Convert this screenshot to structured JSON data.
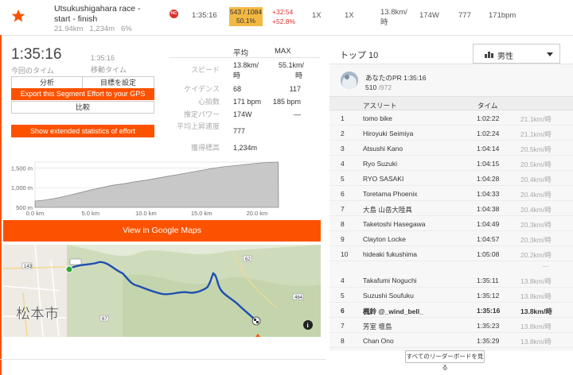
{
  "segment": {
    "title": "Utsukushigahara race -start - finish",
    "distance": "21.94km",
    "elevation": "1,234m",
    "grade": "6%",
    "category_badge": "HC",
    "time": "1:35:16",
    "rank": "543 / 1084",
    "percentile": "50.1%",
    "diff_time": "+32:54",
    "diff_pct": "+52.8%",
    "col_a": "1X",
    "col_b": "1X",
    "speed": "13.8km/時",
    "power": "174W",
    "col_c": "777",
    "heartrate": "171bpm",
    "colors": {
      "accent": "#fc5200",
      "rank_box": "#f3b843",
      "badge": "#d9302a"
    }
  },
  "effort": {
    "elapsed_time": "1:35:16",
    "elapsed_label": "今回のタイム",
    "moving_time": "1:35:16",
    "moving_label": "移動タイム",
    "analyze_label": "分析",
    "set_goal_label": "目標を設定",
    "export_label": "Export this Segment Effort to your GPS",
    "compare_label": "比較",
    "extended_label": "Show extended statistics of effort"
  },
  "stats": {
    "col_avg": "平均",
    "col_max": "MAX",
    "rows": [
      {
        "label": "スピード",
        "avg": "13.8km/時",
        "max": "55.1km/時"
      },
      {
        "label": "ケイデンス",
        "avg": "68",
        "max": "117"
      },
      {
        "label": "心拍数",
        "avg": "171 bpm",
        "max": "185 bpm"
      },
      {
        "label": "推定パワー",
        "avg": "174W",
        "max": "—"
      },
      {
        "label": "平均上昇速度",
        "avg": "777",
        "max": ""
      },
      {
        "label": "獲得標高",
        "avg": "1,234m",
        "max": ""
      }
    ]
  },
  "elevation_chart": {
    "y_ticks": [
      "1,500 m",
      "1,000 m",
      "500 m"
    ],
    "x_ticks": [
      "0.0 km",
      "5.0 km",
      "10.0 km",
      "15.0 km",
      "20.0 km"
    ],
    "profile": [
      [
        0,
        660
      ],
      [
        1,
        690
      ],
      [
        2,
        740
      ],
      [
        3,
        800
      ],
      [
        4,
        870
      ],
      [
        5,
        940
      ],
      [
        6,
        1000
      ],
      [
        7,
        1060
      ],
      [
        8,
        1100
      ],
      [
        9,
        1150
      ],
      [
        10,
        1190
      ],
      [
        11,
        1240
      ],
      [
        12,
        1290
      ],
      [
        13,
        1340
      ],
      [
        14,
        1390
      ],
      [
        15,
        1440
      ],
      [
        16,
        1490
      ],
      [
        17,
        1530
      ],
      [
        18,
        1560
      ],
      [
        19,
        1590
      ],
      [
        20,
        1620
      ],
      [
        21,
        1640
      ],
      [
        21.9,
        1650
      ]
    ]
  },
  "map": {
    "gmaps_label": "View in Google Maps",
    "city_label": "松本市",
    "road_labels": [
      "143",
      "67",
      "62",
      "464"
    ],
    "info_icon": "info-icon"
  },
  "leaderboard": {
    "title": "トップ 10",
    "gender_filter": "男性",
    "pr_title": "あなたのPR 1:35:16",
    "pr_rank": "510",
    "pr_total": "/972",
    "header_athlete": "アスリート",
    "header_time": "タイム",
    "rows": [
      {
        "rank": "1",
        "name": "tomo bike",
        "time": "1:02:22",
        "speed": "21.1km/時"
      },
      {
        "rank": "2",
        "name": "Hiroyuki Seimiya",
        "time": "1:02:24",
        "speed": "21.1km/時"
      },
      {
        "rank": "3",
        "name": "Atsushi Kano",
        "time": "1:04:14",
        "speed": "20.5km/時"
      },
      {
        "rank": "4",
        "name": "Ryo Suzuki",
        "time": "1:04:15",
        "speed": "20.5km/時"
      },
      {
        "rank": "5",
        "name": "RYO SASAKI",
        "time": "1:04:28",
        "speed": "20.4km/時"
      },
      {
        "rank": "6",
        "name": "Toretama Phoenix",
        "time": "1:04:33",
        "speed": "20.4km/時"
      },
      {
        "rank": "7",
        "name": "大島 山岳大陸具",
        "time": "1:04:38",
        "speed": "20.4km/時"
      },
      {
        "rank": "8",
        "name": "Taketoshi Hasegawa",
        "time": "1:04:49",
        "speed": "20.3km/時"
      },
      {
        "rank": "9",
        "name": "Clayton Locke",
        "time": "1:04:57",
        "speed": "20.3km/時"
      },
      {
        "rank": "10",
        "name": "hideaki fukushima",
        "time": "1:05:08",
        "speed": "20.2km/時"
      }
    ],
    "ellipsis": "...",
    "nearby": [
      {
        "rank": "4",
        "name": "Takafumi Noguchi",
        "time": "1:35:11",
        "speed": "13.8km/時"
      },
      {
        "rank": "5",
        "name": "Suzushi Soufuku",
        "time": "1:35:12",
        "speed": "13.8km/時"
      },
      {
        "rank": "6",
        "name": "楓鈴 @_wind_bell_",
        "time": "1:35:16",
        "speed": "13.8km/時"
      },
      {
        "rank": "7",
        "name": "芳室 壇島",
        "time": "1:35:23",
        "speed": "13.8km/時"
      },
      {
        "rank": "8",
        "name": "Chan Ono",
        "time": "1:35:29",
        "speed": "13.8km/時"
      }
    ],
    "full_board_label": "すべてのリーダーボードを見る"
  }
}
